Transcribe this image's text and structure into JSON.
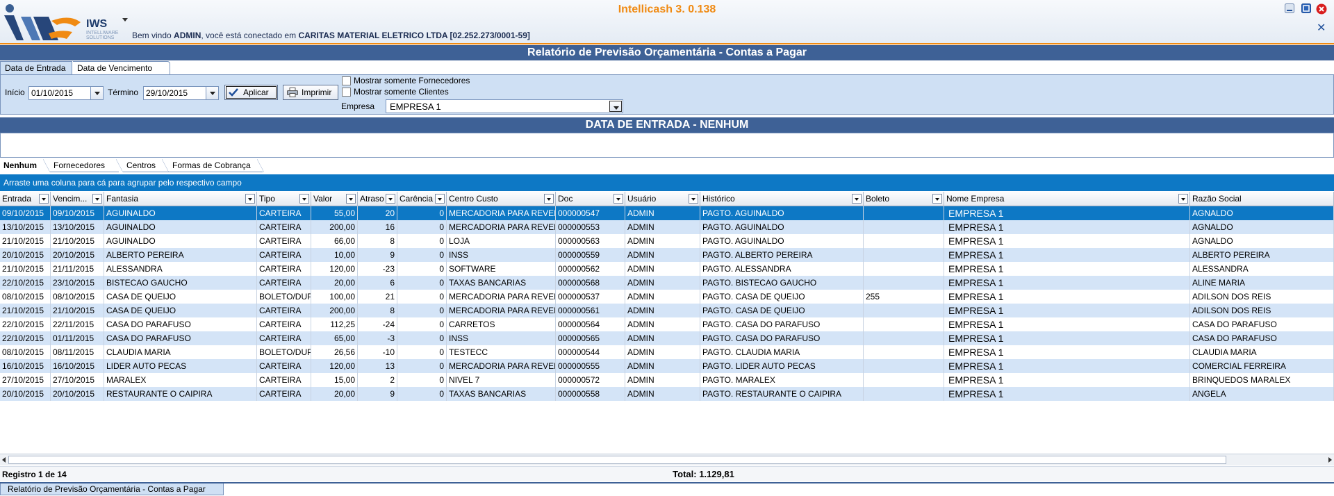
{
  "app": {
    "title": "Intellicash 3. 0.138",
    "logo_text": "IWS",
    "logo_sub": "INTELLIWARE SOLUTIONS",
    "welcome_prefix": "Bem vindo ",
    "user": "ADMIN",
    "welcome_mid": ", você está conectado em ",
    "company": "CARITAS MATERIAL ELETRICO LTDA [02.252.273/0001-59]",
    "accent_color": "#f08a12",
    "bar_color": "#3e6196"
  },
  "report_title": "Relatório de Previsão Orçamentária - Contas a Pagar",
  "tabs_top": [
    "Data de Entrada",
    "Data de Vencimento"
  ],
  "filter": {
    "inicio_label": "Início",
    "inicio_value": "01/10/2015",
    "termino_label": "Término",
    "termino_value": "29/10/2015",
    "apply_label": "Aplicar",
    "print_label": "Imprimir",
    "chk_fornecedores": "Mostrar somente Fornecedores",
    "chk_clientes": "Mostrar somente Clientes",
    "empresa_label": "Empresa",
    "empresa_value": "EMPRESA 1"
  },
  "section_title": "DATA DE ENTRADA - NENHUM",
  "tabs_group": [
    "Nenhum",
    "Fornecedores",
    "Centros",
    "Formas de Cobrança"
  ],
  "group_hint": "Arraste uma coluna para cá para agrupar pelo respectivo campo",
  "columns": [
    "Entrada",
    "Vencim...",
    "Fantasia",
    "Tipo",
    "Valor",
    "Atraso",
    "Carência",
    "Centro Custo",
    "Doc",
    "Usuário",
    "Histórico",
    "Boleto",
    "Nome Empresa",
    "Razão Social"
  ],
  "rows": [
    [
      "09/10/2015",
      "09/10/2015",
      "AGUINALDO",
      "CARTEIRA",
      "55,00",
      "20",
      "0",
      "MERCADORIA PARA REVEN",
      "000000547",
      "ADMIN",
      "PAGTO. AGUINALDO",
      "",
      "EMPRESA 1",
      "AGNALDO"
    ],
    [
      "13/10/2015",
      "13/10/2015",
      "AGUINALDO",
      "CARTEIRA",
      "200,00",
      "16",
      "0",
      "MERCADORIA PARA REVEN",
      "000000553",
      "ADMIN",
      "PAGTO. AGUINALDO",
      "",
      "EMPRESA 1",
      "AGNALDO"
    ],
    [
      "21/10/2015",
      "21/10/2015",
      "AGUINALDO",
      "CARTEIRA",
      "66,00",
      "8",
      "0",
      "LOJA",
      "000000563",
      "ADMIN",
      "PAGTO. AGUINALDO",
      "",
      "EMPRESA 1",
      "AGNALDO"
    ],
    [
      "20/10/2015",
      "20/10/2015",
      "ALBERTO PEREIRA",
      "CARTEIRA",
      "10,00",
      "9",
      "0",
      "INSS",
      "000000559",
      "ADMIN",
      "PAGTO. ALBERTO PEREIRA",
      "",
      "EMPRESA 1",
      "ALBERTO PEREIRA"
    ],
    [
      "21/10/2015",
      "21/11/2015",
      "ALESSANDRA",
      "CARTEIRA",
      "120,00",
      "-23",
      "0",
      "SOFTWARE",
      "000000562",
      "ADMIN",
      "PAGTO. ALESSANDRA",
      "",
      "EMPRESA 1",
      "ALESSANDRA"
    ],
    [
      "22/10/2015",
      "23/10/2015",
      "BISTECAO GAUCHO",
      "CARTEIRA",
      "20,00",
      "6",
      "0",
      "TAXAS BANCARIAS",
      "000000568",
      "ADMIN",
      "PAGTO. BISTECAO GAUCHO",
      "",
      "EMPRESA 1",
      "ALINE MARIA"
    ],
    [
      "08/10/2015",
      "08/10/2015",
      "CASA DE QUEIJO",
      "BOLETO/DUP",
      "100,00",
      "21",
      "0",
      "MERCADORIA PARA REVEN",
      "000000537",
      "ADMIN",
      "PAGTO. CASA DE QUEIJO",
      "255",
      "EMPRESA 1",
      "ADILSON DOS REIS"
    ],
    [
      "21/10/2015",
      "21/10/2015",
      "CASA DE QUEIJO",
      "CARTEIRA",
      "200,00",
      "8",
      "0",
      "MERCADORIA PARA REVEN",
      "000000561",
      "ADMIN",
      "PAGTO. CASA DE QUEIJO",
      "",
      "EMPRESA 1",
      "ADILSON DOS REIS"
    ],
    [
      "22/10/2015",
      "22/11/2015",
      "CASA DO PARAFUSO",
      "CARTEIRA",
      "112,25",
      "-24",
      "0",
      "CARRETOS",
      "000000564",
      "ADMIN",
      "PAGTO. CASA DO PARAFUSO",
      "",
      "EMPRESA 1",
      "CASA DO PARAFUSO"
    ],
    [
      "22/10/2015",
      "01/11/2015",
      "CASA DO PARAFUSO",
      "CARTEIRA",
      "65,00",
      "-3",
      "0",
      "INSS",
      "000000565",
      "ADMIN",
      "PAGTO. CASA DO PARAFUSO",
      "",
      "EMPRESA 1",
      "CASA DO PARAFUSO"
    ],
    [
      "08/10/2015",
      "08/11/2015",
      "CLAUDIA MARIA",
      "BOLETO/DUP",
      "26,56",
      "-10",
      "0",
      "TESTECC",
      "000000544",
      "ADMIN",
      "PAGTO. CLAUDIA MARIA",
      "",
      "EMPRESA 1",
      "CLAUDIA MARIA"
    ],
    [
      "16/10/2015",
      "16/10/2015",
      "LIDER AUTO PECAS",
      "CARTEIRA",
      "120,00",
      "13",
      "0",
      "MERCADORIA PARA REVEN",
      "000000555",
      "ADMIN",
      "PAGTO. LIDER AUTO PECAS",
      "",
      "EMPRESA 1",
      "COMERCIAL FERREIRA"
    ],
    [
      "27/10/2015",
      "27/10/2015",
      "MARALEX",
      "CARTEIRA",
      "15,00",
      "2",
      "0",
      "NIVEL 7",
      "000000572",
      "ADMIN",
      "PAGTO. MARALEX",
      "",
      "EMPRESA 1",
      "BRINQUEDOS MARALEX"
    ],
    [
      "20/10/2015",
      "20/10/2015",
      "RESTAURANTE O CAIPIRA",
      "CARTEIRA",
      "20,00",
      "9",
      "0",
      "TAXAS BANCARIAS",
      "000000558",
      "ADMIN",
      "PAGTO. RESTAURANTE O CAIPIRA",
      "",
      "EMPRESA 1",
      "ANGELA"
    ]
  ],
  "footer": {
    "registro": "Registro 1 de 14",
    "total": "Total: 1.129,81"
  },
  "bottom_tab": "Relatório de Previsão Orçamentária - Contas a Pagar"
}
